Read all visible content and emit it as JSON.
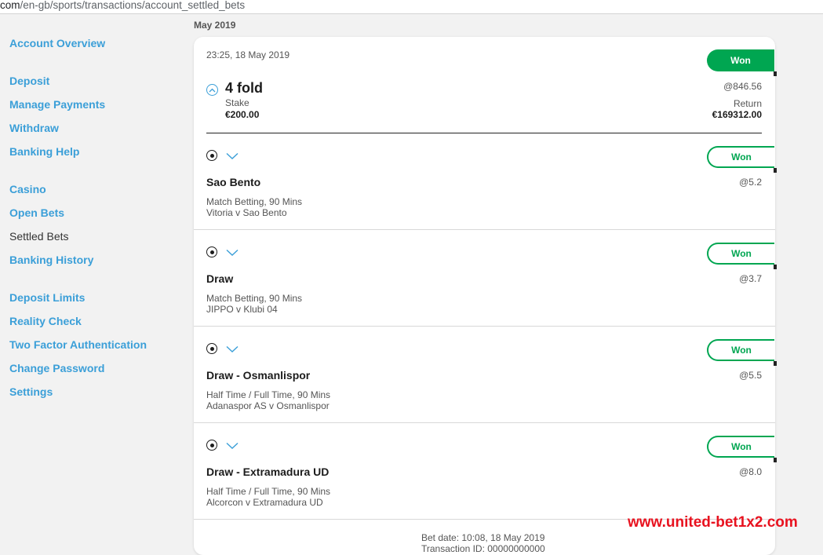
{
  "browser": {
    "url_prefix": "com",
    "url_path": "/en-gb/sports/transactions/account_settled_bets"
  },
  "sidebar": {
    "items": [
      {
        "label": "Account Overview"
      },
      {
        "label": "Deposit"
      },
      {
        "label": "Manage Payments"
      },
      {
        "label": "Withdraw"
      },
      {
        "label": "Banking Help"
      },
      {
        "label": "Casino"
      },
      {
        "label": "Open Bets"
      },
      {
        "label": "Settled Bets",
        "active": true
      },
      {
        "label": "Banking History"
      },
      {
        "label": "Deposit Limits"
      },
      {
        "label": "Reality Check"
      },
      {
        "label": "Two Factor Authentication"
      },
      {
        "label": "Change Password"
      },
      {
        "label": "Settings"
      }
    ]
  },
  "month_heading": "May 2019",
  "bet": {
    "datetime": "23:25, 18 May 2019",
    "status": "Won",
    "type": "4 fold",
    "odds": "@846.56",
    "stake_label": "Stake",
    "stake_value": "€200.00",
    "return_label": "Return",
    "return_value": "€169312.00",
    "legs": [
      {
        "status": "Won",
        "selection": "Sao Bento",
        "odds": "@5.2",
        "market": "Match Betting, 90 Mins",
        "event": "Vitoria v Sao Bento"
      },
      {
        "status": "Won",
        "selection": "Draw",
        "odds": "@3.7",
        "market": "Match Betting, 90 Mins",
        "event": "JIPPO v Klubi 04"
      },
      {
        "status": "Won",
        "selection": "Draw - Osmanlispor",
        "odds": "@5.5",
        "market": "Half Time / Full Time, 90 Mins",
        "event": "Adanaspor AS v Osmanlispor"
      },
      {
        "status": "Won",
        "selection": "Draw - Extramadura UD",
        "odds": "@8.0",
        "market": "Half Time / Full Time, 90 Mins",
        "event": "Alcorcon v Extramadura UD"
      }
    ],
    "bet_date": "Bet date: 10:08, 18 May 2019",
    "transaction_partial": "Transaction ID: 00000000000"
  },
  "watermark": "www.united-bet1x2.com",
  "colors": {
    "won_green": "#00a651",
    "link_blue": "#3b9fd8",
    "watermark_red": "#e8121f"
  },
  "icons": {
    "expand": "chevron-up-circle-icon",
    "leg": "football-icon",
    "toggle": "chevron-down-icon"
  }
}
